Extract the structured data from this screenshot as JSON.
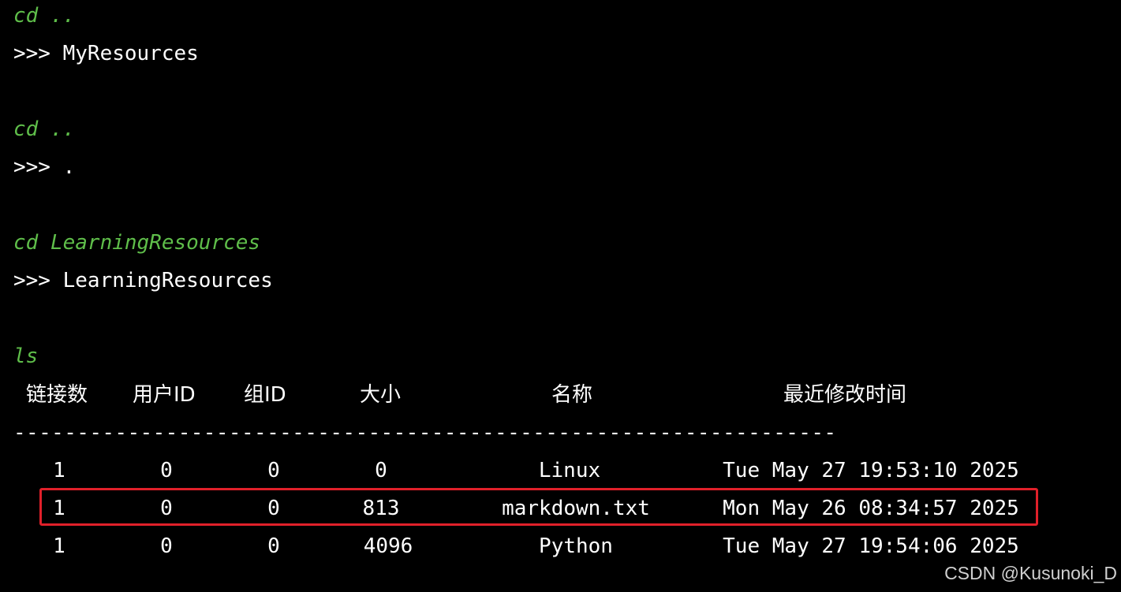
{
  "colors": {
    "background": "#000000",
    "command": "#5fbe4a",
    "output": "#ffffff",
    "highlight_border": "#e0202a"
  },
  "transcript": [
    {
      "command": "cd ..",
      "output": ">>> MyResources"
    },
    {
      "command": "cd ..",
      "output": ">>> ."
    },
    {
      "command": "cd LearningResources",
      "output": ">>> LearningResources"
    },
    {
      "command": "ls"
    }
  ],
  "listing": {
    "headers": [
      "链接数",
      "用户ID",
      "组ID",
      "大小",
      "名称",
      "最近修改时间"
    ],
    "separator": "-----------------------------------------------------------------",
    "rows": [
      {
        "links": "1",
        "uid": "0",
        "gid": "0",
        "size": "0",
        "name": "Linux",
        "mtime": "Tue May 27 19:53:10 2025",
        "highlighted": false
      },
      {
        "links": "1",
        "uid": "0",
        "gid": "0",
        "size": "813",
        "name": "markdown.txt",
        "mtime": "Mon May 26 08:34:57 2025",
        "highlighted": true
      },
      {
        "links": "1",
        "uid": "0",
        "gid": "0",
        "size": "4096",
        "name": "Python",
        "mtime": "Tue May 27 19:54:06 2025",
        "highlighted": false
      }
    ]
  },
  "watermark": "CSDN @Kusunoki_D"
}
